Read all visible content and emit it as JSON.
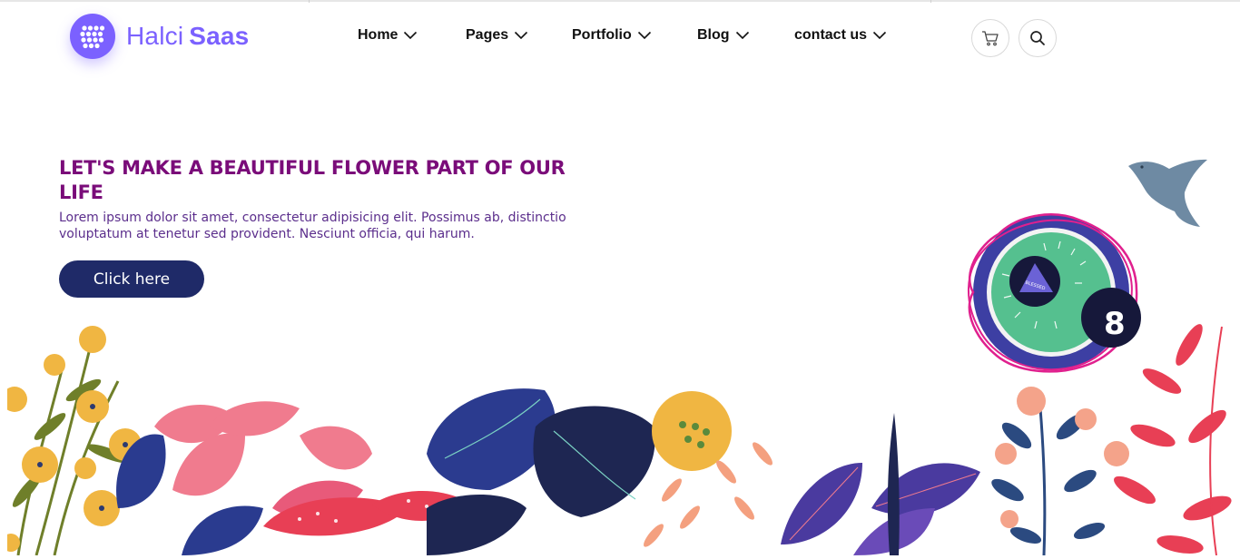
{
  "brand": {
    "name_light": "Halci",
    "name_bold": "Saas",
    "accent_color": "#7b61ff",
    "logo_icon": "grid-dots-icon"
  },
  "nav": {
    "items": [
      {
        "label": "Home",
        "icon": "chevron-down-icon"
      },
      {
        "label": "Pages",
        "icon": "chevron-down-icon"
      },
      {
        "label": "Portfolio",
        "icon": "chevron-down-icon"
      },
      {
        "label": "Blog",
        "icon": "chevron-down-icon"
      },
      {
        "label": "contact us",
        "icon": "chevron-down-icon"
      }
    ],
    "actions": [
      {
        "icon": "cart-icon"
      },
      {
        "icon": "search-icon"
      }
    ]
  },
  "hero": {
    "title": "LET'S MAKE A BEAUTIFUL FLOWER PART OF OUR LIFE",
    "text": "Lorem ipsum dolor sit amet, consectetur adipisicing elit. Possimus ab, distinctio voluptatum at tenetur sed provident. Nesciunt officia, qui harum.",
    "cta_label": "Click here",
    "title_color": "#7a0c79",
    "text_color": "#5b2e8c",
    "button_color": "#1f2a68"
  },
  "illustration": {
    "badge_text": "BLESSED",
    "badge_icon": "triangle-badge-icon",
    "bird_icon": "bird-icon"
  }
}
